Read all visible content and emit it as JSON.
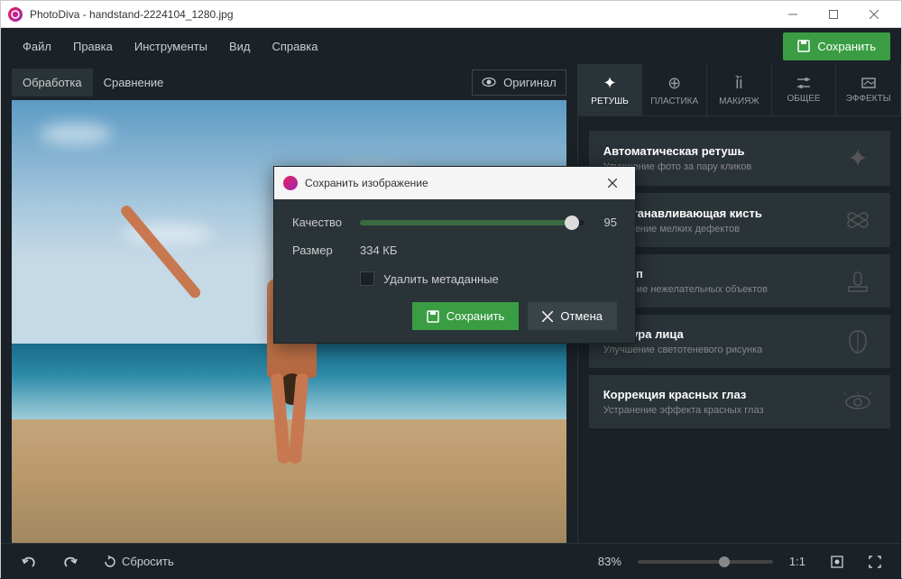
{
  "titlebar": {
    "title": "PhotoDiva - handstand-2224104_1280.jpg"
  },
  "menu": {
    "items": [
      "Файл",
      "Правка",
      "Инструменты",
      "Вид",
      "Справка"
    ],
    "save_label": "Сохранить"
  },
  "image_tabs": {
    "processing": "Обработка",
    "comparison": "Сравнение",
    "original_toggle": "Оригинал"
  },
  "tool_tabs": [
    {
      "label": "РЕТУШЬ"
    },
    {
      "label": "ПЛАСТИКА"
    },
    {
      "label": "МАКИЯЖ"
    },
    {
      "label": "ОБЩЕЕ"
    },
    {
      "label": "ЭФФЕКТЫ"
    }
  ],
  "tool_cards": [
    {
      "title": "Автоматическая ретушь",
      "sub": "Улучшение фото за пару кликов"
    },
    {
      "title": "Восстанавливающая кисть",
      "sub": "Устранение мелких дефектов"
    },
    {
      "title": "Штамп",
      "sub": "Удаление нежелательных объектов"
    },
    {
      "title": "Фактура лица",
      "sub": "Улучшение светотеневого рисунка"
    },
    {
      "title": "Коррекция красных глаз",
      "sub": "Устранение эффекта красных глаз"
    }
  ],
  "bottombar": {
    "reset": "Сбросить",
    "zoom": "83%",
    "ratio": "1:1"
  },
  "dialog": {
    "title": "Сохранить изображение",
    "quality_label": "Качество",
    "quality_value": "95",
    "size_label": "Размер",
    "size_value": "334 КБ",
    "checkbox_label": "Удалить метаданные",
    "save_label": "Сохранить",
    "cancel_label": "Отмена"
  }
}
